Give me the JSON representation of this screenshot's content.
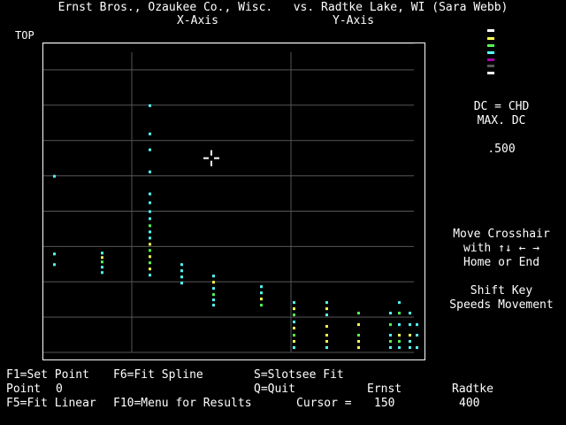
{
  "title": "Ernst Bros., Ozaukee Co., Wisc.   vs. Radtke Lake, WI (Sara Webb)",
  "x_axis_label": "X-Axis",
  "y_axis_label": "Y-Axis",
  "top_label": "TOP",
  "legend": {
    "colors": [
      "#ffffff",
      "#ffff55",
      "#55ff55",
      "#55ffff",
      "#aa00aa",
      "#555555"
    ]
  },
  "dc_info": {
    "line1": "DC = CHD",
    "line2": "MAX. DC",
    "value": ".500"
  },
  "instructions": {
    "line1": "Move Crosshair",
    "line2": "with ↑↓ ← →",
    "line3": "Home or End",
    "line4": "Shift Key",
    "line5": "Speeds Movement"
  },
  "footer": {
    "f1": "F1=Set Point",
    "f6": "F6=Fit Spline",
    "s": "S=Slotsee Fit",
    "point_label": "Point",
    "point_value": "0",
    "q": "Q=Quit",
    "col1_header": "Ernst",
    "col2_header": "Radtke",
    "f5": "F5=Fit Linear",
    "f10": "F10=Menu for Results",
    "cursor_label": "Cursor =",
    "cursor_x": "150",
    "cursor_y": "400"
  },
  "chart_data": {
    "type": "scatter",
    "marker_columns": [
      {
        "x": 12,
        "points": [
          {
            "y": 140,
            "c": "#55ffff"
          },
          {
            "y": 52,
            "c": "#55ffff"
          },
          {
            "y": 40,
            "c": "#55ffff"
          }
        ]
      },
      {
        "x": 66,
        "points": [
          {
            "y": 53,
            "c": "#55ffff"
          },
          {
            "y": 48,
            "c": "#ffff55"
          },
          {
            "y": 43,
            "c": "#55ff55"
          },
          {
            "y": 37,
            "c": "#55ffff"
          },
          {
            "y": 31,
            "c": "#55ffff"
          }
        ]
      },
      {
        "x": 120,
        "points": [
          {
            "y": 220,
            "c": "#55ffff"
          },
          {
            "y": 188,
            "c": "#55ffff"
          },
          {
            "y": 170,
            "c": "#55ffff"
          },
          {
            "y": 145,
            "c": "#55ffff"
          },
          {
            "y": 120,
            "c": "#55ffff"
          },
          {
            "y": 110,
            "c": "#55ffff"
          },
          {
            "y": 100,
            "c": "#55ffff"
          },
          {
            "y": 92,
            "c": "#55ffff"
          },
          {
            "y": 84,
            "c": "#55ff55"
          },
          {
            "y": 77,
            "c": "#55ffff"
          },
          {
            "y": 70,
            "c": "#55ffff"
          },
          {
            "y": 63,
            "c": "#ffff55"
          },
          {
            "y": 56,
            "c": "#55ff55"
          },
          {
            "y": 49,
            "c": "#ffff55"
          },
          {
            "y": 42,
            "c": "#55ff55"
          },
          {
            "y": 35,
            "c": "#ffff55"
          },
          {
            "y": 28,
            "c": "#55ffff"
          }
        ]
      },
      {
        "x": 156,
        "points": [
          {
            "y": 40,
            "c": "#55ffff"
          },
          {
            "y": 33,
            "c": "#55ffff"
          },
          {
            "y": 26,
            "c": "#55ffff"
          },
          {
            "y": 19,
            "c": "#55ffff"
          }
        ]
      },
      {
        "x": 192,
        "points": [
          {
            "y": 27,
            "c": "#55ffff"
          },
          {
            "y": 20,
            "c": "#ffff55"
          },
          {
            "y": 13,
            "c": "#55ffff"
          },
          {
            "y": 6,
            "c": "#55ff55"
          },
          {
            "y": 0,
            "c": "#55ffff"
          },
          {
            "y": -6,
            "c": "#55ffff"
          }
        ]
      },
      {
        "x": 246,
        "points": [
          {
            "y": 15,
            "c": "#55ffff"
          },
          {
            "y": 8,
            "c": "#55ffff"
          },
          {
            "y": 1,
            "c": "#ffff55"
          },
          {
            "y": -6,
            "c": "#55ff55"
          }
        ]
      },
      {
        "x": 283,
        "points": [
          {
            "y": -3,
            "c": "#55ffff"
          },
          {
            "y": -10,
            "c": "#ffff55"
          },
          {
            "y": -17,
            "c": "#55ff55"
          },
          {
            "y": -25,
            "c": "#55ffff"
          },
          {
            "y": -32,
            "c": "#ffff55"
          },
          {
            "y": -40,
            "c": "#55ff55"
          },
          {
            "y": -47,
            "c": "#ffff55"
          },
          {
            "y": -54,
            "c": "#55ffff"
          }
        ]
      },
      {
        "x": 320,
        "points": [
          {
            "y": -3,
            "c": "#55ffff"
          },
          {
            "y": -10,
            "c": "#ffff55"
          },
          {
            "y": -17,
            "c": "#55ffff"
          },
          {
            "y": -30,
            "c": "#ffff55"
          },
          {
            "y": -40,
            "c": "#ffff55"
          },
          {
            "y": -47,
            "c": "#ffff55"
          },
          {
            "y": -54,
            "c": "#55ffff"
          }
        ]
      },
      {
        "x": 356,
        "points": [
          {
            "y": -15,
            "c": "#55ff55"
          },
          {
            "y": -28,
            "c": "#ffff55"
          },
          {
            "y": -40,
            "c": "#55ff55"
          },
          {
            "y": -47,
            "c": "#ffff55"
          },
          {
            "y": -54,
            "c": "#ffff55"
          }
        ]
      },
      {
        "x": 392,
        "points": [
          {
            "y": -15,
            "c": "#55ffff"
          },
          {
            "y": -28,
            "c": "#55ff55"
          },
          {
            "y": -40,
            "c": "#55ffff"
          },
          {
            "y": -47,
            "c": "#55ff55"
          },
          {
            "y": -54,
            "c": "#55ffff"
          }
        ]
      },
      {
        "x": 402,
        "points": [
          {
            "y": -3,
            "c": "#55ffff"
          },
          {
            "y": -15,
            "c": "#55ff55"
          },
          {
            "y": -28,
            "c": "#55ffff"
          },
          {
            "y": -40,
            "c": "#ffff55"
          },
          {
            "y": -47,
            "c": "#55ff55"
          },
          {
            "y": -54,
            "c": "#55ffff"
          }
        ]
      },
      {
        "x": 414,
        "points": [
          {
            "y": -15,
            "c": "#55ffff"
          },
          {
            "y": -28,
            "c": "#55ffff"
          },
          {
            "y": -40,
            "c": "#ffff55"
          },
          {
            "y": -47,
            "c": "#55ffff"
          },
          {
            "y": -54,
            "c": "#55ffff"
          }
        ]
      },
      {
        "x": 422,
        "points": [
          {
            "y": -28,
            "c": "#55ffff"
          },
          {
            "y": -40,
            "c": "#55ffff"
          },
          {
            "y": -54,
            "c": "#55ffff"
          }
        ]
      }
    ],
    "crosshair": {
      "x": 190,
      "y": 160
    },
    "xlim": [
      0,
      433
    ],
    "ylim": [
      -70,
      290
    ],
    "gridlines_x": [
      100,
      280
    ],
    "gridlines_y": [
      -60,
      -20,
      20,
      60,
      100,
      140,
      180,
      220,
      260,
      290
    ]
  }
}
